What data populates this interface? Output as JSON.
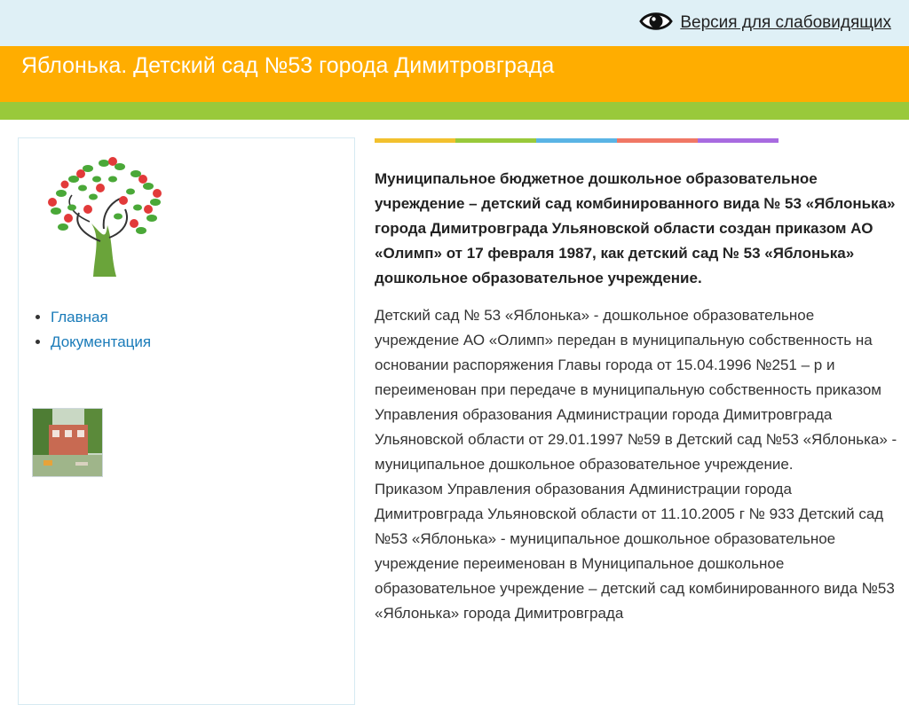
{
  "topbar": {
    "accessibility_label": "Версия для слабовидящих",
    "icon": "eye-icon"
  },
  "header": {
    "title": "Яблонька. Детский сад №53 города Димитровграда"
  },
  "colors": {
    "topbar_bg": "#dff0f6",
    "header_bg": "#ffad00",
    "green_strip": "#99c93b",
    "link": "#1a7bb9",
    "colorbar": [
      "#f2c12e",
      "#99c93b",
      "#5ab4e5",
      "#f07765",
      "#a86be0"
    ]
  },
  "sidebar": {
    "logo_icon": "apple-tree-icon",
    "nav": [
      {
        "label": "Главная"
      },
      {
        "label": "Документация"
      }
    ],
    "photo_icon": "kindergarten-photo"
  },
  "content": {
    "lead": "Муниципальное бюджетное дошкольное образовательное учреждение – детский сад комбинированного вида № 53 «Яблонька» города Димитровграда Ульяновской области создан приказом АО «Олимп» от 17 февраля 1987, как детский сад № 53 «Яблонька» дошкольное образовательное учреждение.",
    "p1": "Детский сад № 53 «Яблонька» - дошкольное образовательное учреждение АО «Олимп» передан в муниципальную собственность на основании распоряжения Главы города от 15.04.1996 №251 – р и переименован при передаче в муниципальную собственность приказом Управления образования Администрации города Димитровграда Ульяновской области от 29.01.1997 №59 в Детский сад №53 «Яблонька» - муниципальное дошкольное образовательное учреждение.",
    "p2": "Приказом Управления образования Администрации города Димитровграда Ульяновской области от 11.10.2005 г № 933 Детский сад №53 «Яблонька» - муниципальное дошкольное образовательное учреждение переименован в Муниципальное дошкольное образовательное учреждение – детский сад комбинированного вида №53 «Яблонька» города Димитровграда"
  }
}
